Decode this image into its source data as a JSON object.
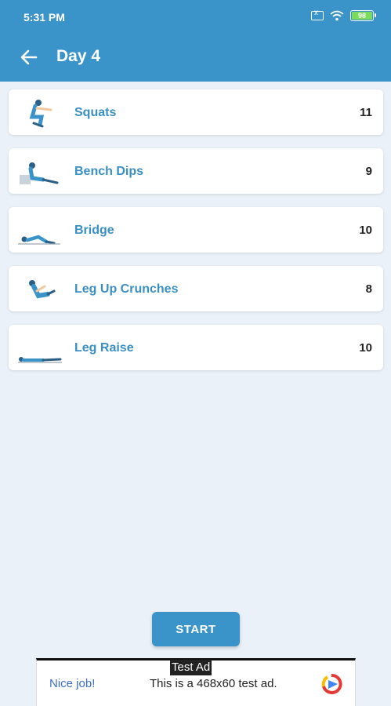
{
  "status_bar": {
    "time": "5:31 PM",
    "battery": "98"
  },
  "header": {
    "title": "Day 4"
  },
  "exercises": [
    {
      "name": "Squats",
      "count": "11"
    },
    {
      "name": "Bench Dips",
      "count": "9"
    },
    {
      "name": "Bridge",
      "count": "10"
    },
    {
      "name": "Leg Up Crunches",
      "count": "8"
    },
    {
      "name": "Leg Raise",
      "count": "10"
    }
  ],
  "start_label": "START",
  "ad": {
    "label": "Test Ad",
    "headline": "Nice job!",
    "body": "This is a 468x60 test ad."
  },
  "colors": {
    "accent": "#3a93c9",
    "background": "#eaf1f8"
  },
  "icons": [
    "back-arrow-icon",
    "sim-icon",
    "wifi-icon",
    "battery-icon"
  ]
}
